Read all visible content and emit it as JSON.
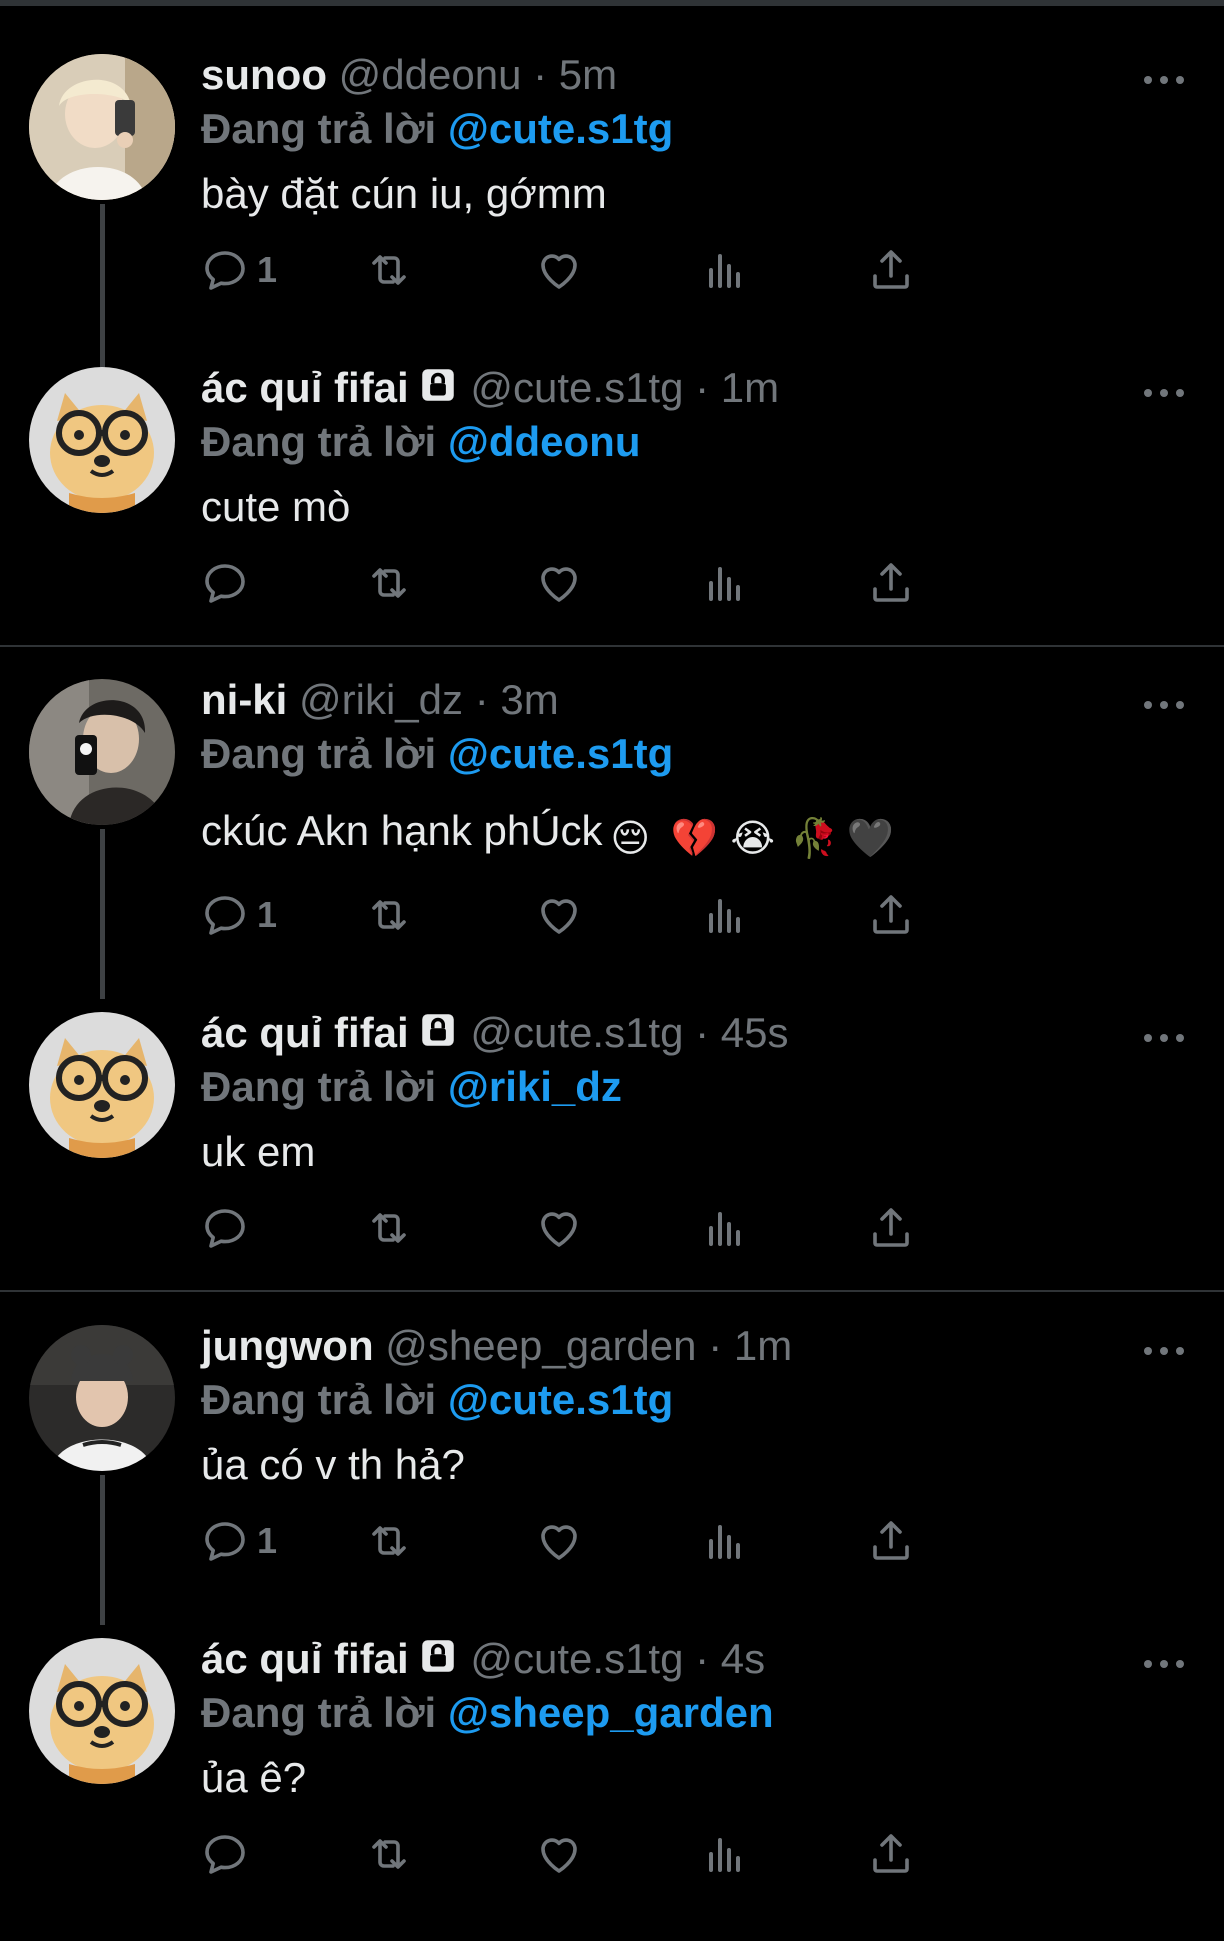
{
  "threads": [
    {
      "tweets": [
        {
          "name": "sunoo",
          "handle": "@ddeonu",
          "time": "· 5m",
          "reply_prefix": "Đang trả lời",
          "reply_to": "@cute.s1tg",
          "text": "bày đặt cún iu, gớmm",
          "reply_count": "1",
          "avatar_icon": "person-photo-icon"
        },
        {
          "name": "ác quỉ fifai",
          "handle": "@cute.s1tg",
          "time": "· 1m",
          "reply_prefix": "Đang trả lời",
          "reply_to": "@ddeonu",
          "text": "cute mò",
          "reply_count": "",
          "avatar_icon": "dog-with-glasses-icon"
        }
      ]
    },
    {
      "tweets": [
        {
          "name": "ni-ki",
          "handle": "@riki_dz",
          "time": "· 3m",
          "reply_prefix": "Đang trả lời",
          "reply_to": "@cute.s1tg",
          "text": "ckúc Akn hạnk phÚck",
          "emojis": [
            "😔",
            "💔",
            "😭",
            "🥀",
            "🖤"
          ],
          "reply_count": "1",
          "avatar_icon": "person-photo-icon"
        },
        {
          "name": "ác quỉ fifai",
          "handle": "@cute.s1tg",
          "time": "· 45s",
          "reply_prefix": "Đang trả lời",
          "reply_to": "@riki_dz",
          "text": "uk em",
          "reply_count": "",
          "avatar_icon": "dog-with-glasses-icon"
        }
      ]
    },
    {
      "tweets": [
        {
          "name": "jungwon",
          "handle": "@sheep_garden",
          "time": "· 1m",
          "reply_prefix": "Đang trả lời",
          "reply_to": "@cute.s1tg",
          "text": "ủa có v th hả?",
          "reply_count": "1",
          "avatar_icon": "person-photo-icon"
        },
        {
          "name": "ác quỉ fifai",
          "handle": "@cute.s1tg",
          "time": "· 4s",
          "reply_prefix": "Đang trả lời",
          "reply_to": "@sheep_garden",
          "text": "ủa ê?",
          "reply_count": "",
          "avatar_icon": "dog-with-glasses-icon"
        }
      ]
    }
  ],
  "icons": {
    "reply": "reply-icon",
    "retweet": "retweet-icon",
    "like": "heart-icon",
    "analytics": "analytics-icon",
    "share": "share-icon",
    "more": "more-icon",
    "lock": "lock-icon"
  },
  "colors": {
    "background": "#000000",
    "text": "#e7e9ea",
    "muted": "#71767b",
    "link": "#1d9bf0",
    "divider": "#2f3336"
  }
}
